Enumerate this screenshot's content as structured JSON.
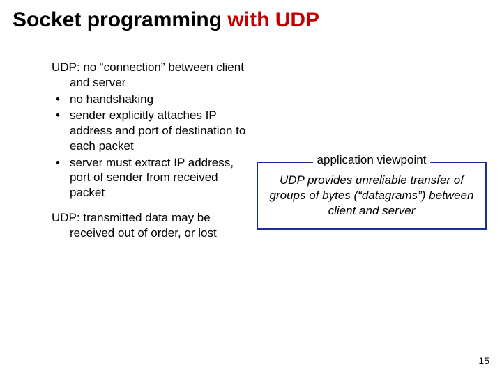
{
  "title": {
    "part1": "Socket programming ",
    "part2": "with UDP"
  },
  "left": {
    "intro_lead": "UDP:",
    "intro_rest": " no “connection” between client and server",
    "bullets": [
      "no handshaking",
      "sender explicitly attaches IP address and port of destination to each packet",
      "server must extract IP address, port of sender from received packet"
    ],
    "note_lead": "UDP:",
    "note_rest": " transmitted data may be received out of order, or lost"
  },
  "box": {
    "legend": "application viewpoint",
    "line_pre": "UDP provides ",
    "line_ul": "unreliable",
    "line_post": " transfer of groups of bytes (“datagrams”) between client and server"
  },
  "page_number": "15"
}
